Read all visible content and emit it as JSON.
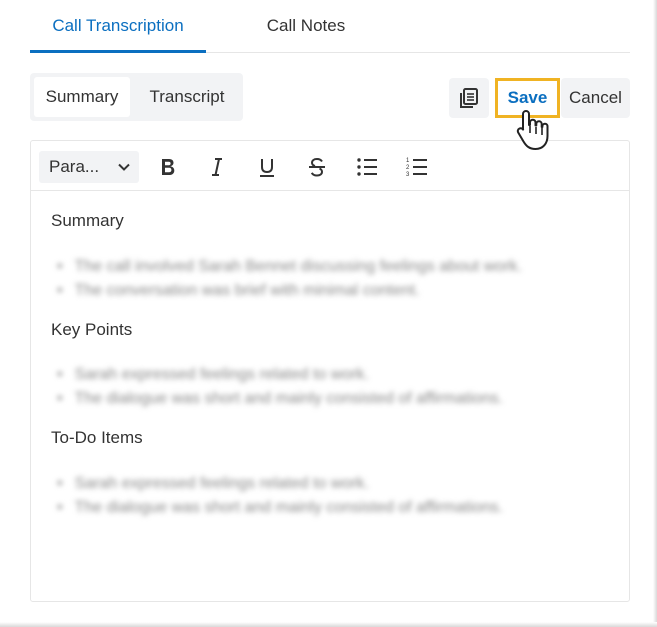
{
  "top_tabs": {
    "transcription": "Call Transcription",
    "notes": "Call Notes"
  },
  "segment": {
    "summary": "Summary",
    "transcript": "Transcript"
  },
  "actions": {
    "copy_icon": "copy-icon",
    "save": "Save",
    "cancel": "Cancel"
  },
  "toolbar": {
    "paragraph_select": "Para...",
    "icons": [
      "bold-icon",
      "italic-icon",
      "underline-icon",
      "strikethrough-icon",
      "bullet-list-icon",
      "numbered-list-icon"
    ]
  },
  "content": {
    "sections": [
      {
        "heading": "Summary",
        "items": [
          "The call involved Sarah Bennet discussing feelings about work.",
          "The conversation was brief with minimal content."
        ]
      },
      {
        "heading": "Key Points",
        "items": [
          "Sarah expressed feelings related to work.",
          "The dialogue was short and mainly consisted of affirmations."
        ]
      },
      {
        "heading": "To-Do Items",
        "items": [
          "Sarah expressed feelings related to work.",
          "The dialogue was short and mainly consisted of affirmations."
        ]
      }
    ]
  },
  "colors": {
    "accent": "#0b6fc0",
    "highlight": "#f0b323",
    "button_bg": "#f2f3f5"
  }
}
